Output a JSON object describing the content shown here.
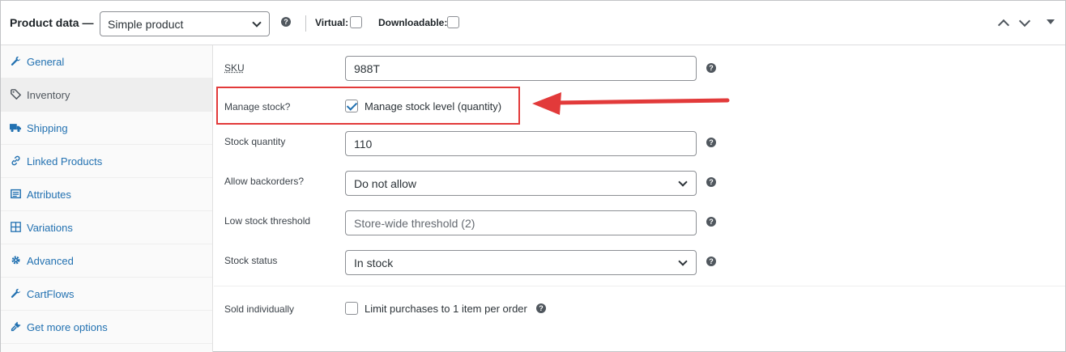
{
  "header": {
    "title": "Product data —",
    "product_type": "Simple product",
    "virtual_label": "Virtual:",
    "downloadable_label": "Downloadable:"
  },
  "sidebar": {
    "items": [
      {
        "label": "General",
        "icon": "wrench-icon"
      },
      {
        "label": "Inventory",
        "icon": "tag-icon",
        "active": true
      },
      {
        "label": "Shipping",
        "icon": "truck-icon"
      },
      {
        "label": "Linked Products",
        "icon": "link-icon"
      },
      {
        "label": "Attributes",
        "icon": "list-icon"
      },
      {
        "label": "Variations",
        "icon": "grid-icon"
      },
      {
        "label": "Advanced",
        "icon": "gear-icon"
      },
      {
        "label": "CartFlows",
        "icon": "wrench-icon"
      },
      {
        "label": "Get more options",
        "icon": "plug-icon"
      }
    ]
  },
  "form": {
    "sku_label": "SKU",
    "sku_value": "988T",
    "manage_stock_label": "Manage stock?",
    "manage_stock_checkbox_label": "Manage stock level (quantity)",
    "manage_stock_checked": true,
    "stock_quantity_label": "Stock quantity",
    "stock_quantity_value": "110",
    "backorders_label": "Allow backorders?",
    "backorders_value": "Do not allow",
    "low_stock_label": "Low stock threshold",
    "low_stock_placeholder": "Store-wide threshold (2)",
    "stock_status_label": "Stock status",
    "stock_status_value": "In stock",
    "sold_individually_label": "Sold individually",
    "sold_individually_checkbox_label": "Limit purchases to 1 item per order",
    "sold_individually_checked": false
  },
  "annotation": {
    "highlight_color": "#e23a3a"
  },
  "colors": {
    "link": "#2271b1",
    "border": "#8c8f94"
  }
}
